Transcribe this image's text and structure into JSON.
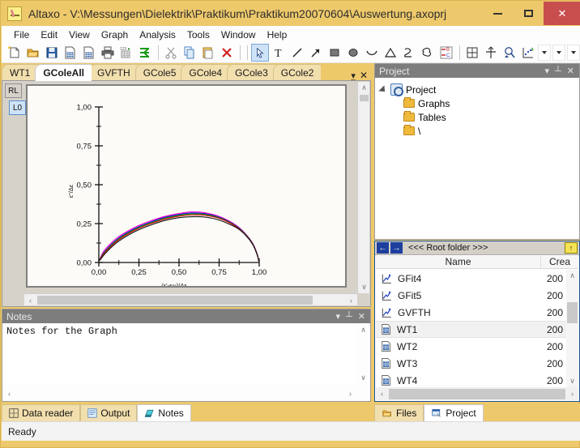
{
  "window": {
    "title": "Altaxo - V:\\Messungen\\Dielektrik\\Praktikum\\Praktikum20070604\\Auswertung.axoprj",
    "app_icon": "altaxo-icon",
    "minimize_label": "–",
    "maximize_label": "□",
    "close_label": "✕",
    "accent_titlebar": "#eec96b",
    "accent_close": "#c84e4e"
  },
  "menubar": {
    "items": [
      "File",
      "Edit",
      "View",
      "Graph",
      "Analysis",
      "Tools",
      "Window",
      "Help"
    ]
  },
  "toolbar": {
    "groups": [
      [
        "new-document-icon",
        "open-folder-icon",
        "save-icon",
        "new-worksheet-icon",
        "open-worksheet-icon",
        "print-icon",
        "numeric-table-icon",
        "export-icon"
      ],
      [
        "cut-icon",
        "copy-icon",
        "paste-icon",
        "delete-icon"
      ],
      [
        "pointer-tool-icon",
        "text-tool-icon",
        "line-tool-icon",
        "arrow-tool-icon",
        "rectangle-tool-icon",
        "ellipse-tool-icon",
        "curve-tool-icon",
        "triangle-tool-icon",
        "open-curve-tool-icon",
        "closed-curve-tool-icon",
        "plot-item-icon"
      ],
      [
        "fit-to-page-icon",
        "crosshair-icon",
        "zoom-icon",
        "data-pick-icon"
      ]
    ],
    "dropdowns": [
      "dropdown-1",
      "dropdown-2",
      "dropdown-3"
    ],
    "overflow_label": "⋮"
  },
  "document_tabs": {
    "tabs": [
      {
        "label": "WT1",
        "active": false
      },
      {
        "label": "GColeAll",
        "active": true
      },
      {
        "label": "GVFTH",
        "active": false
      },
      {
        "label": "GCole5",
        "active": false
      },
      {
        "label": "GCole4",
        "active": false
      },
      {
        "label": "GCole3",
        "active": false
      },
      {
        "label": "GCole2",
        "active": false
      }
    ],
    "overflow_icon": "tab-list-icon",
    "close_icon": "close-tab-icon"
  },
  "graph_panel": {
    "layer_buttons": [
      {
        "label": "RL",
        "selected": false
      },
      {
        "label": "L0",
        "selected": true
      }
    ],
    "scroll_up": "∧",
    "scroll_down": "∨",
    "scroll_left": "‹",
    "scroll_right": "›"
  },
  "chart_data": {
    "type": "scatter",
    "title": "",
    "xlabel": "(ε'-ε∞)/Δε",
    "ylabel": "ε\"/Δε",
    "xlim": [
      0.0,
      1.0
    ],
    "ylim": [
      0.0,
      1.0
    ],
    "xticks": [
      "0,00",
      "0,25",
      "0,50",
      "0,75",
      "1,00"
    ],
    "xtick_values": [
      0.0,
      0.25,
      0.5,
      0.75,
      1.0
    ],
    "yticks": [
      "0,00",
      "0,25",
      "0,50",
      "0,75",
      "1,00"
    ],
    "ytick_values": [
      0.0,
      0.25,
      0.5,
      0.75,
      1.0
    ],
    "grid": false,
    "legend": "none",
    "minor_ticks": true,
    "axis_style": "left-bottom-L",
    "background": "#fdfbf7",
    "description": "Cole-Cole plot: five overlapping depressed semicircular arcs of normalized dielectric loss vs normalized permittivity",
    "series": [
      {
        "name": "curve-magenta",
        "color": "#ff00c8",
        "peak": {
          "x": 0.56,
          "y": 0.325
        },
        "x": [
          0.005,
          0.03,
          0.07,
          0.12,
          0.18,
          0.25,
          0.33,
          0.41,
          0.5,
          0.58,
          0.66,
          0.74,
          0.81,
          0.87,
          0.92,
          0.96,
          0.985,
          0.997
        ],
        "y": [
          0.02,
          0.072,
          0.118,
          0.163,
          0.202,
          0.238,
          0.27,
          0.296,
          0.315,
          0.325,
          0.32,
          0.3,
          0.268,
          0.228,
          0.178,
          0.122,
          0.062,
          0.018
        ]
      },
      {
        "name": "curve-blue",
        "color": "#1414dc",
        "peak": {
          "x": 0.56,
          "y": 0.318
        },
        "x": [
          0.005,
          0.03,
          0.07,
          0.12,
          0.18,
          0.25,
          0.33,
          0.41,
          0.5,
          0.58,
          0.66,
          0.74,
          0.81,
          0.87,
          0.92,
          0.96,
          0.985,
          0.997
        ],
        "y": [
          0.018,
          0.062,
          0.108,
          0.154,
          0.194,
          0.231,
          0.263,
          0.29,
          0.309,
          0.318,
          0.314,
          0.295,
          0.264,
          0.225,
          0.176,
          0.12,
          0.06,
          0.016
        ]
      },
      {
        "name": "curve-green",
        "color": "#00a000",
        "peak": {
          "x": 0.57,
          "y": 0.312
        },
        "x": [
          0.005,
          0.03,
          0.07,
          0.12,
          0.18,
          0.25,
          0.33,
          0.41,
          0.5,
          0.58,
          0.66,
          0.74,
          0.81,
          0.87,
          0.92,
          0.96,
          0.985,
          0.997
        ],
        "y": [
          0.017,
          0.058,
          0.103,
          0.148,
          0.188,
          0.225,
          0.257,
          0.284,
          0.303,
          0.312,
          0.309,
          0.291,
          0.261,
          0.222,
          0.174,
          0.118,
          0.058,
          0.014
        ]
      },
      {
        "name": "curve-red",
        "color": "#d00000",
        "peak": {
          "x": 0.57,
          "y": 0.306
        },
        "x": [
          0.005,
          0.03,
          0.07,
          0.12,
          0.18,
          0.25,
          0.33,
          0.41,
          0.5,
          0.58,
          0.66,
          0.74,
          0.81,
          0.87,
          0.92,
          0.96,
          0.985,
          0.997
        ],
        "y": [
          0.015,
          0.053,
          0.098,
          0.143,
          0.183,
          0.22,
          0.252,
          0.279,
          0.298,
          0.306,
          0.304,
          0.287,
          0.258,
          0.22,
          0.172,
          0.117,
          0.057,
          0.013
        ]
      },
      {
        "name": "curve-black",
        "color": "#101010",
        "peak": {
          "x": 0.6,
          "y": 0.294
        },
        "x": [
          0.005,
          0.03,
          0.07,
          0.12,
          0.18,
          0.25,
          0.33,
          0.41,
          0.5,
          0.58,
          0.66,
          0.74,
          0.81,
          0.87,
          0.92,
          0.96,
          0.985,
          0.997
        ],
        "y": [
          0.012,
          0.046,
          0.09,
          0.134,
          0.174,
          0.211,
          0.243,
          0.27,
          0.288,
          0.294,
          0.292,
          0.276,
          0.248,
          0.216,
          0.17,
          0.115,
          0.056,
          0.012
        ]
      }
    ]
  },
  "notes_panel": {
    "caption": "Notes",
    "text": "Notes for the Graph",
    "menu_icon": "chevron-down-icon",
    "pin_icon": "pin-icon",
    "close_icon": "close-icon"
  },
  "bottom_tabs": {
    "tabs": [
      {
        "label": "Data reader",
        "icon": "data-reader-icon",
        "active": false
      },
      {
        "label": "Output",
        "icon": "output-icon",
        "active": false
      },
      {
        "label": "Notes",
        "icon": "notes-icon",
        "active": true
      }
    ]
  },
  "statusbar": {
    "text": "Ready"
  },
  "project_panel": {
    "caption": "Project",
    "menu_icon": "chevron-down-icon",
    "pin_icon": "pin-icon",
    "close_icon": "close-icon",
    "tree": [
      {
        "label": "Project",
        "icon": "project-icon",
        "level": 0,
        "expanded": true
      },
      {
        "label": "Graphs",
        "icon": "folder-icon",
        "level": 1
      },
      {
        "label": "Tables",
        "icon": "folder-icon",
        "level": 1
      },
      {
        "label": "\\",
        "icon": "folder-icon",
        "level": 1
      }
    ]
  },
  "files_panel": {
    "back_label": "←",
    "forward_label": "→",
    "folder_label": "<<< Root folder >>>",
    "up_label": "↑",
    "columns": [
      "Name",
      "Crea"
    ],
    "rows": [
      {
        "name": "GFit4",
        "created": "200",
        "icon": "graph-icon",
        "selected": false
      },
      {
        "name": "GFit5",
        "created": "200",
        "icon": "graph-icon",
        "selected": false
      },
      {
        "name": "GVFTH",
        "created": "200",
        "icon": "graph-icon",
        "selected": false
      },
      {
        "name": "WT1",
        "created": "200",
        "icon": "table-icon",
        "selected": true
      },
      {
        "name": "WT2",
        "created": "200",
        "icon": "table-icon",
        "selected": false
      },
      {
        "name": "WT3",
        "created": "200",
        "icon": "table-icon",
        "selected": false
      },
      {
        "name": "WT4",
        "created": "200",
        "icon": "table-icon",
        "selected": false
      }
    ],
    "scroll_up": "∧",
    "scroll_down": "∨",
    "scroll_left": "‹",
    "scroll_right": "›"
  },
  "right_bottom_tabs": {
    "tabs": [
      {
        "label": "Files",
        "icon": "folder-open-icon",
        "active": false
      },
      {
        "label": "Project",
        "icon": "project-window-icon",
        "active": true
      }
    ]
  }
}
